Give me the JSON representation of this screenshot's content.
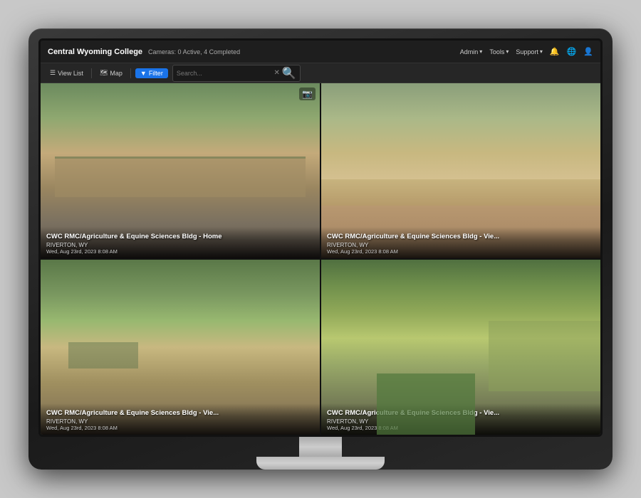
{
  "monitor": {
    "brand_title": "Central Wyoming College"
  },
  "navbar": {
    "brand": "Central Wyoming College",
    "cameras_status": "Cameras: 0 Active, 4 Completed",
    "admin_label": "Admin",
    "tools_label": "Tools",
    "support_label": "Support"
  },
  "toolbar": {
    "view_list_label": "View List",
    "map_label": "Map",
    "filter_label": "Filter",
    "search_placeholder": "Search..."
  },
  "cameras": [
    {
      "id": "cam-1",
      "title": "CWC RMC/Agriculture & Equine Sciences Bldg - Home",
      "location": "RIVERTON, WY",
      "timestamp": "Wed, Aug 23rd, 2023 8:08 AM",
      "has_icon": true
    },
    {
      "id": "cam-2",
      "title": "CWC RMC/Agriculture & Equine Sciences Bldg - Vie...",
      "location": "RIVERTON, WY",
      "timestamp": "Wed, Aug 23rd, 2023 8:08 AM",
      "has_icon": false
    },
    {
      "id": "cam-3",
      "title": "CWC RMC/Agriculture & Equine Sciences Bldg - Vie...",
      "location": "RIVERTON, WY",
      "timestamp": "Wed, Aug 23rd, 2023 8:08 AM",
      "has_icon": false
    },
    {
      "id": "cam-4",
      "title": "CWC RMC/Agriculture & Equine Sciences Bldg - Vie...",
      "location": "RIVERTON, WY",
      "timestamp": "Wed, Aug 23rd, 2023 8:08 AM",
      "has_icon": false
    }
  ]
}
